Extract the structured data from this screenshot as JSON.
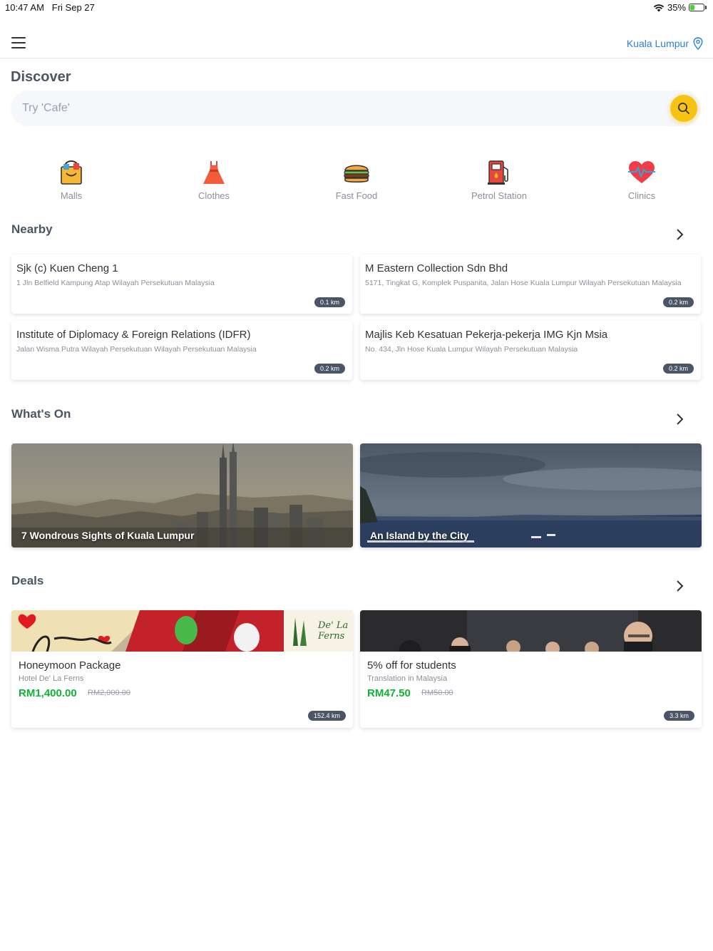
{
  "status_bar": {
    "time": "10:47 AM",
    "date": "Fri Sep 27",
    "battery": "35%",
    "battery_level": 0.35
  },
  "header": {
    "location": "Kuala Lumpur"
  },
  "discover": {
    "title": "Discover",
    "search_placeholder": "Try 'Cafe'"
  },
  "categories": [
    {
      "label": "Malls",
      "icon": "shopping-bag-icon"
    },
    {
      "label": "Clothes",
      "icon": "dress-icon"
    },
    {
      "label": "Fast Food",
      "icon": "burger-icon"
    },
    {
      "label": "Petrol Station",
      "icon": "fuel-pump-icon"
    },
    {
      "label": "Clinics",
      "icon": "heart-pulse-icon"
    }
  ],
  "nearby": {
    "title": "Nearby",
    "items": [
      {
        "name": "Sjk (c) Kuen Cheng 1",
        "address": "1 Jln Belfield Kampung Atap Wilayah Persekutuan Malaysia",
        "distance": "0.1 km"
      },
      {
        "name": "M Eastern Collection Sdn Bhd",
        "address": "5171, Tingkat G, Komplek Puspanita, Jalan Hose Kuala Lumpur Wilayah Persekutuan Malaysia",
        "distance": "0.2 km"
      },
      {
        "name": "Institute of Diplomacy & Foreign Relations (IDFR)",
        "address": "Jalan Wisma Putra Wilayah Persekutuan Wilayah Persekutuan Malaysia",
        "distance": "0.2 km"
      },
      {
        "name": "Majlis Keb Kesatuan Pekerja-pekerja IMG Kjn Msia",
        "address": "No. 434, Jln Hose Kuala Lumpur Wilayah Persekutuan Malaysia",
        "distance": "0.2 km"
      }
    ]
  },
  "whats_on": {
    "title": "What's On",
    "items": [
      {
        "caption": "7 Wondrous Sights of Kuala Lumpur"
      },
      {
        "caption": "An Island by the City"
      }
    ]
  },
  "deals": {
    "title": "Deals",
    "items": [
      {
        "title": "Honeymoon Package",
        "merchant": "Hotel De' La Ferns",
        "price": "RM1,400.00",
        "old_price": "RM2,000.00",
        "distance": "152.4 km",
        "logo_text": "De' La Ferns"
      },
      {
        "title": "5% off for students",
        "merchant": "Translation in Malaysia",
        "price": "RM47.50",
        "old_price": "RM50.00",
        "distance": "3.3 km"
      }
    ]
  },
  "colors": {
    "accent": "#2d7fd8",
    "search_button": "#f7c313",
    "price": "#10b335",
    "badge": "#4a5566"
  }
}
